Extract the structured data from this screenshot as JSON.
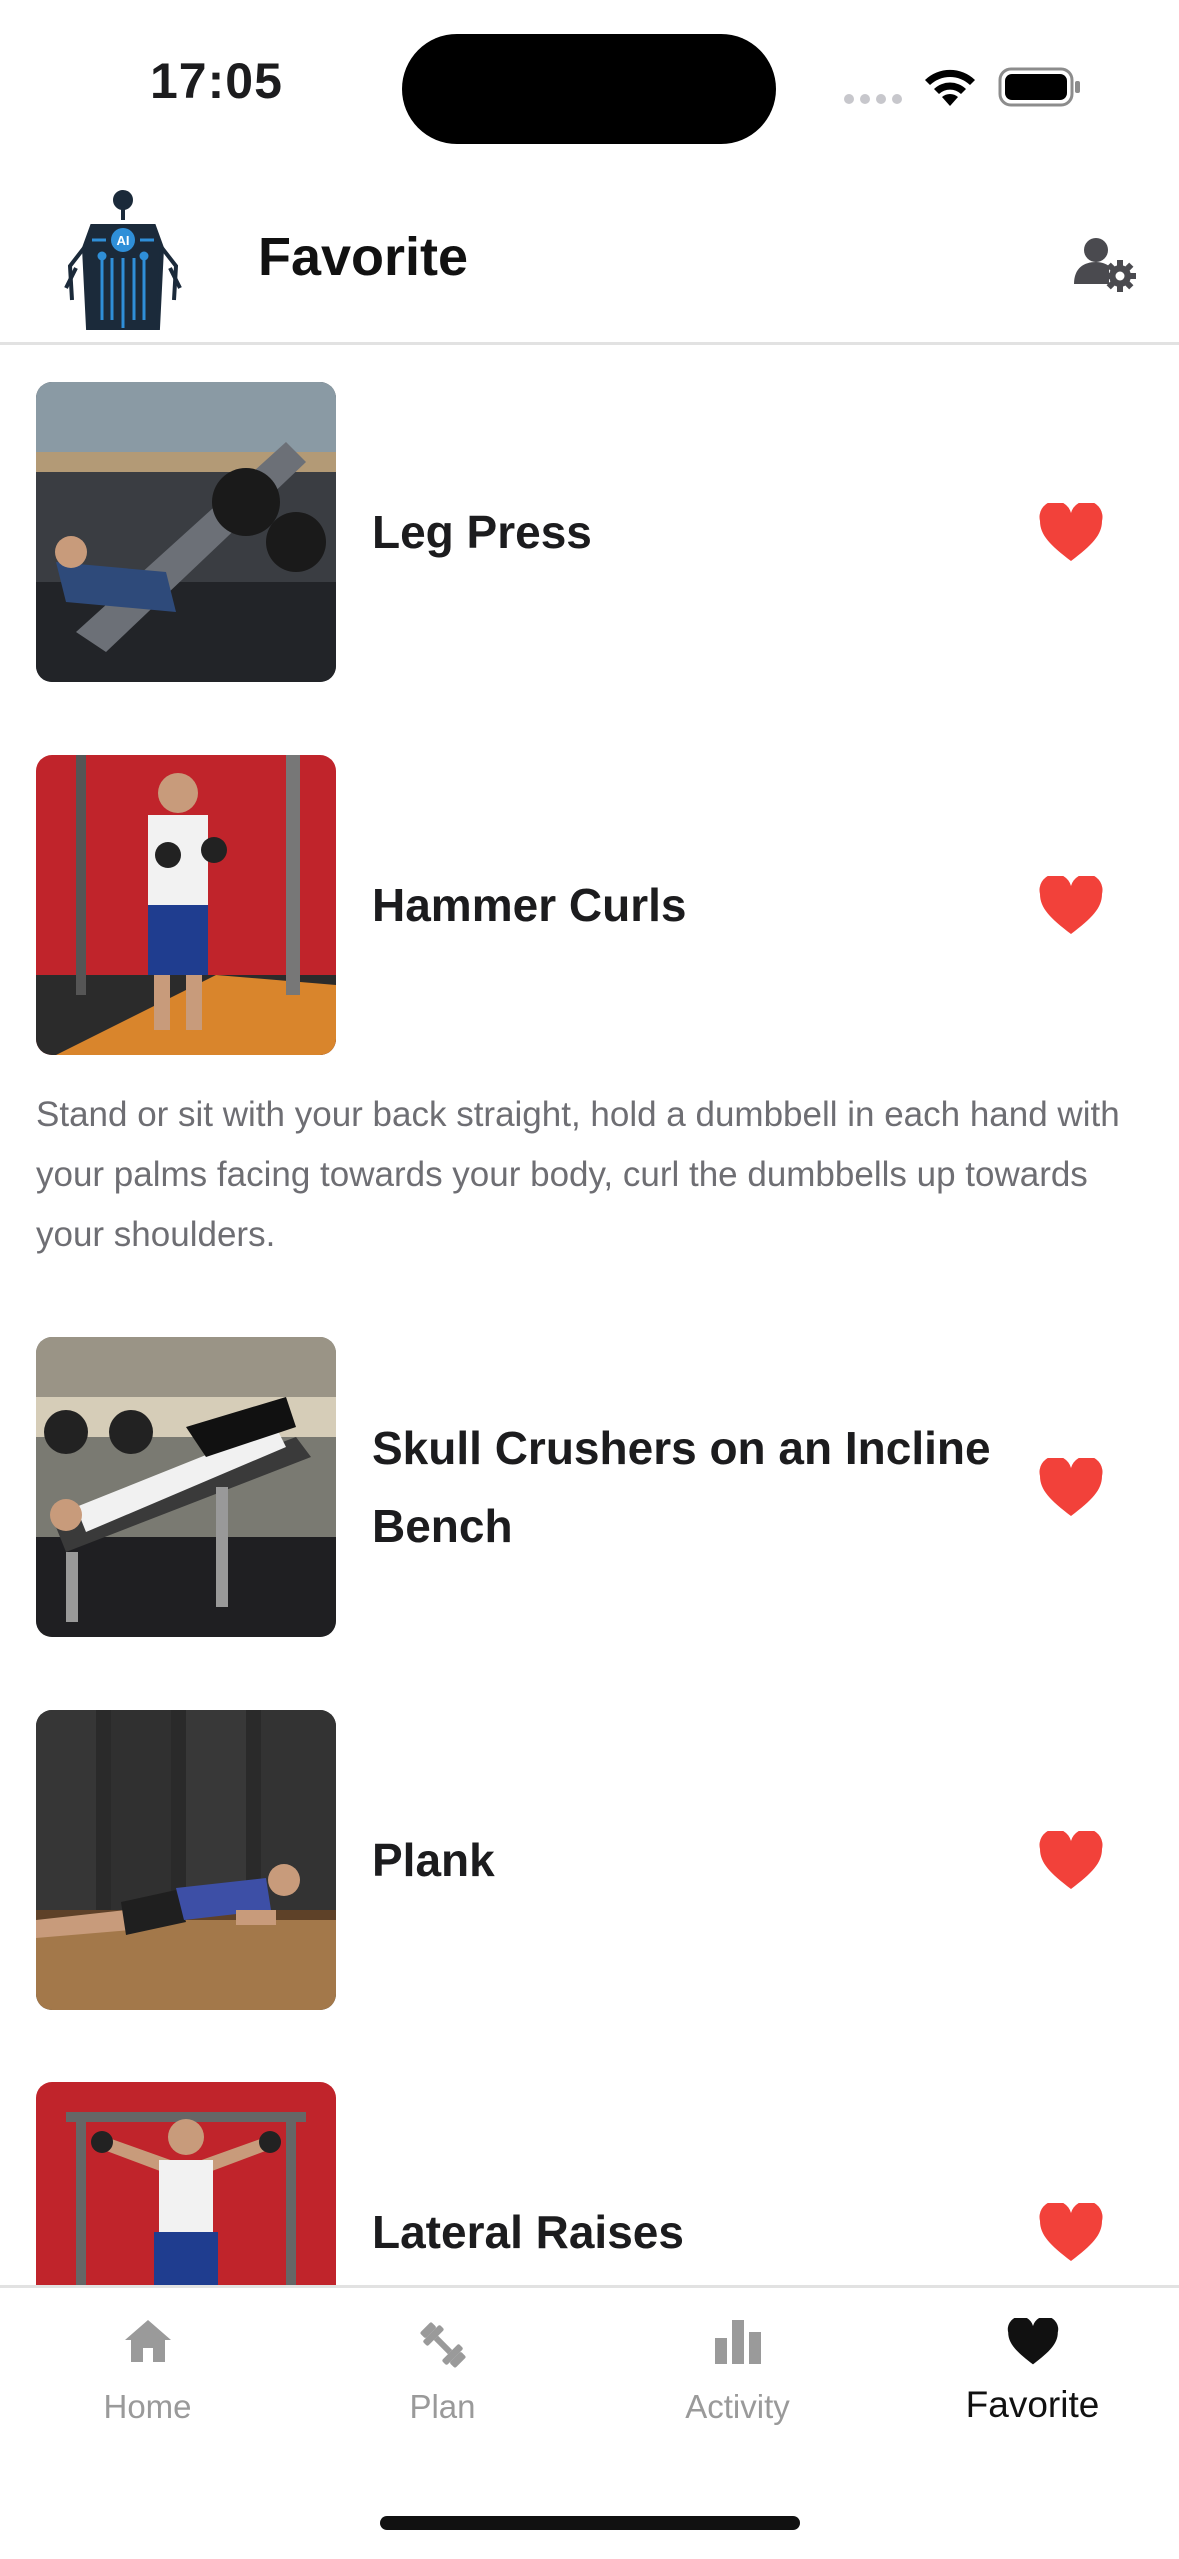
{
  "status_bar": {
    "time": "17:05"
  },
  "header": {
    "title": "Favorite",
    "logo_text": "AI"
  },
  "colors": {
    "heart": "#f2413a",
    "tab_active": "#111111",
    "tab_inactive": "#9a9a9a"
  },
  "exercises": [
    {
      "name": "Leg Press",
      "favorite": true
    },
    {
      "name": "Hammer Curls",
      "favorite": true,
      "description": "Stand or sit with your back straight, hold a dumbbell in each hand with your palms facing towards your body, curl the dumbbells up towards your shoulders."
    },
    {
      "name": "Skull Crushers on an Incline Bench",
      "favorite": true
    },
    {
      "name": "Plank",
      "favorite": true
    },
    {
      "name": "Lateral Raises",
      "favorite": true
    }
  ],
  "tabs": [
    {
      "label": "Home",
      "icon": "home-icon",
      "active": false
    },
    {
      "label": "Plan",
      "icon": "dumbbell-icon",
      "active": false
    },
    {
      "label": "Activity",
      "icon": "bar-chart-icon",
      "active": false
    },
    {
      "label": "Favorite",
      "icon": "heart-icon",
      "active": true
    }
  ]
}
